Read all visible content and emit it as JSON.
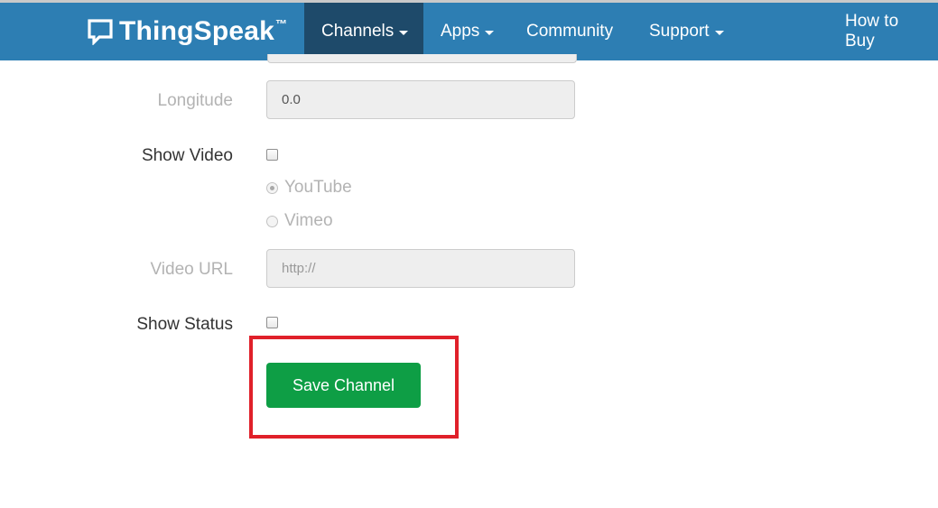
{
  "navbar": {
    "brand": {
      "name": "ThingSpeak",
      "tm": "™"
    },
    "items": [
      {
        "label": "Channels",
        "dropdown": true,
        "active": true
      },
      {
        "label": "Apps",
        "dropdown": true,
        "active": false
      },
      {
        "label": "Community",
        "dropdown": false,
        "active": false
      },
      {
        "label": "Support",
        "dropdown": true,
        "active": false
      },
      {
        "label": "How to Buy",
        "dropdown": false,
        "active": false
      }
    ]
  },
  "form": {
    "longitude": {
      "label": "Longitude",
      "value": "0.0"
    },
    "show_video": {
      "label": "Show Video",
      "checked": false
    },
    "video_options": [
      {
        "label": "YouTube",
        "selected": true
      },
      {
        "label": "Vimeo",
        "selected": false
      }
    ],
    "video_url": {
      "label": "Video URL",
      "placeholder": "http://"
    },
    "show_status": {
      "label": "Show Status",
      "checked": false
    },
    "save_button": "Save Channel"
  },
  "colors": {
    "navbar": "#2d7eb3",
    "navbar_active": "#1e4a6a",
    "save_button": "#0e9e45",
    "highlight": "#e0202a"
  },
  "icons": {
    "brand": "speech-bubble-icon",
    "dropdown": "caret-down-icon"
  }
}
